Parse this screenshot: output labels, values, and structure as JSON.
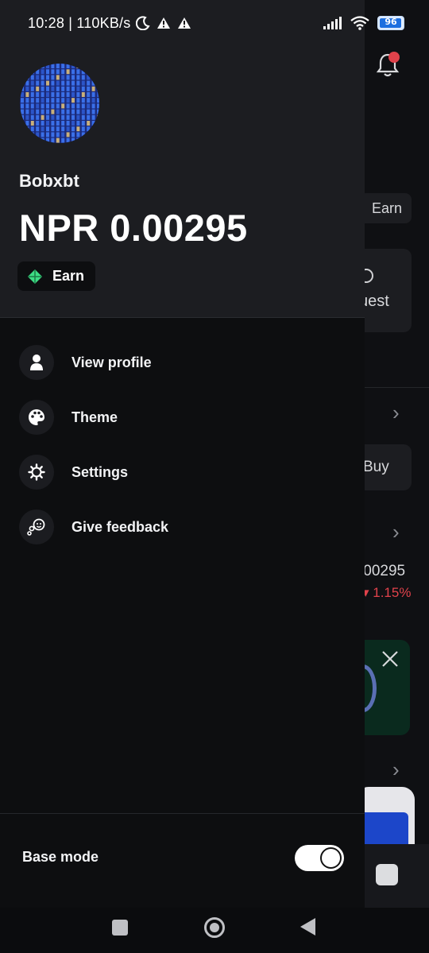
{
  "status_bar": {
    "time": "10:28 | 110KB/s",
    "battery": "96"
  },
  "profile": {
    "username": "Bobxbt",
    "balance": "NPR 0.00295",
    "earn_label": "Earn"
  },
  "menu": {
    "items": [
      {
        "label": "View profile",
        "icon": "person-icon"
      },
      {
        "label": "Theme",
        "icon": "palette-icon"
      },
      {
        "label": "Settings",
        "icon": "gear-icon"
      },
      {
        "label": "Give feedback",
        "icon": "feedback-icon"
      }
    ]
  },
  "base_mode": {
    "label": "Base mode",
    "enabled": true
  },
  "background": {
    "earn": "Earn",
    "quest": "uest",
    "buy": "Buy",
    "price": ".00295",
    "change": "▾ 1.15%"
  },
  "colors": {
    "drawer_header": "#1c1d21",
    "drawer_body": "#0d0e10",
    "accent_green": "#3ddc84",
    "negative": "#e0424b"
  }
}
